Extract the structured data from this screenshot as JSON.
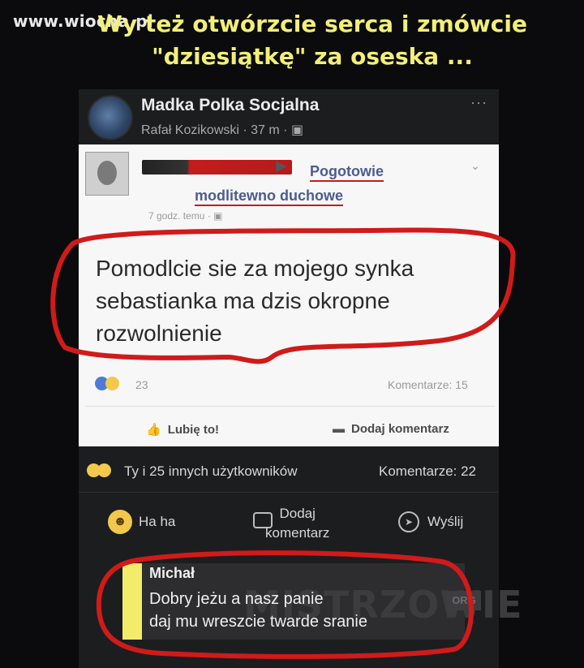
{
  "watermark": "www.wiocha.pl",
  "headline": {
    "line1": "Wy też otwórzcie serca i zmówcie",
    "line2": "\"dziesiątkę\" za oseska ..."
  },
  "shared_post": {
    "group_name": "Madka Polka Socjalna",
    "author": "Rafał Kozikowski · 37 m ·",
    "more": "···"
  },
  "original_post": {
    "page_name_line1": "Pogotowie",
    "page_name_line2": "modlitewno duchowe",
    "time": "7 godz. temu ·",
    "text": "Pomodlcie sie za mojego synka sebastianka ma dzis okropne rozwolnienie",
    "reaction_count": "23",
    "comments": "Komentarze: 15",
    "like_label": "Lubię to!",
    "comment_label": "Dodaj komentarz"
  },
  "outer": {
    "likers": "Ty i 25 innych użytkowników",
    "comments": "Komentarze: 22",
    "haha_label": "Ha ha",
    "comment_label_line1": "Dodaj",
    "comment_label_line2": "komentarz",
    "share_label": "Wyślij"
  },
  "comment": {
    "author": "Michał",
    "text_line1": "Dobry jeżu a nasz panie",
    "text_line2": "daj mu wreszcie twarde sranie",
    "watermark": "MISTRZOWIE",
    "watermark_org": "ORG"
  },
  "colors": {
    "headline": "#f2ef7a",
    "annotation_red": "#d11a1a",
    "card_bg": "#1c1d1f",
    "comment_bar": "#f2ec6a"
  },
  "icons": [
    "like-icon",
    "sad-icon",
    "haha-icon",
    "wow-icon",
    "comment-icon",
    "share-icon",
    "globe-icon"
  ]
}
